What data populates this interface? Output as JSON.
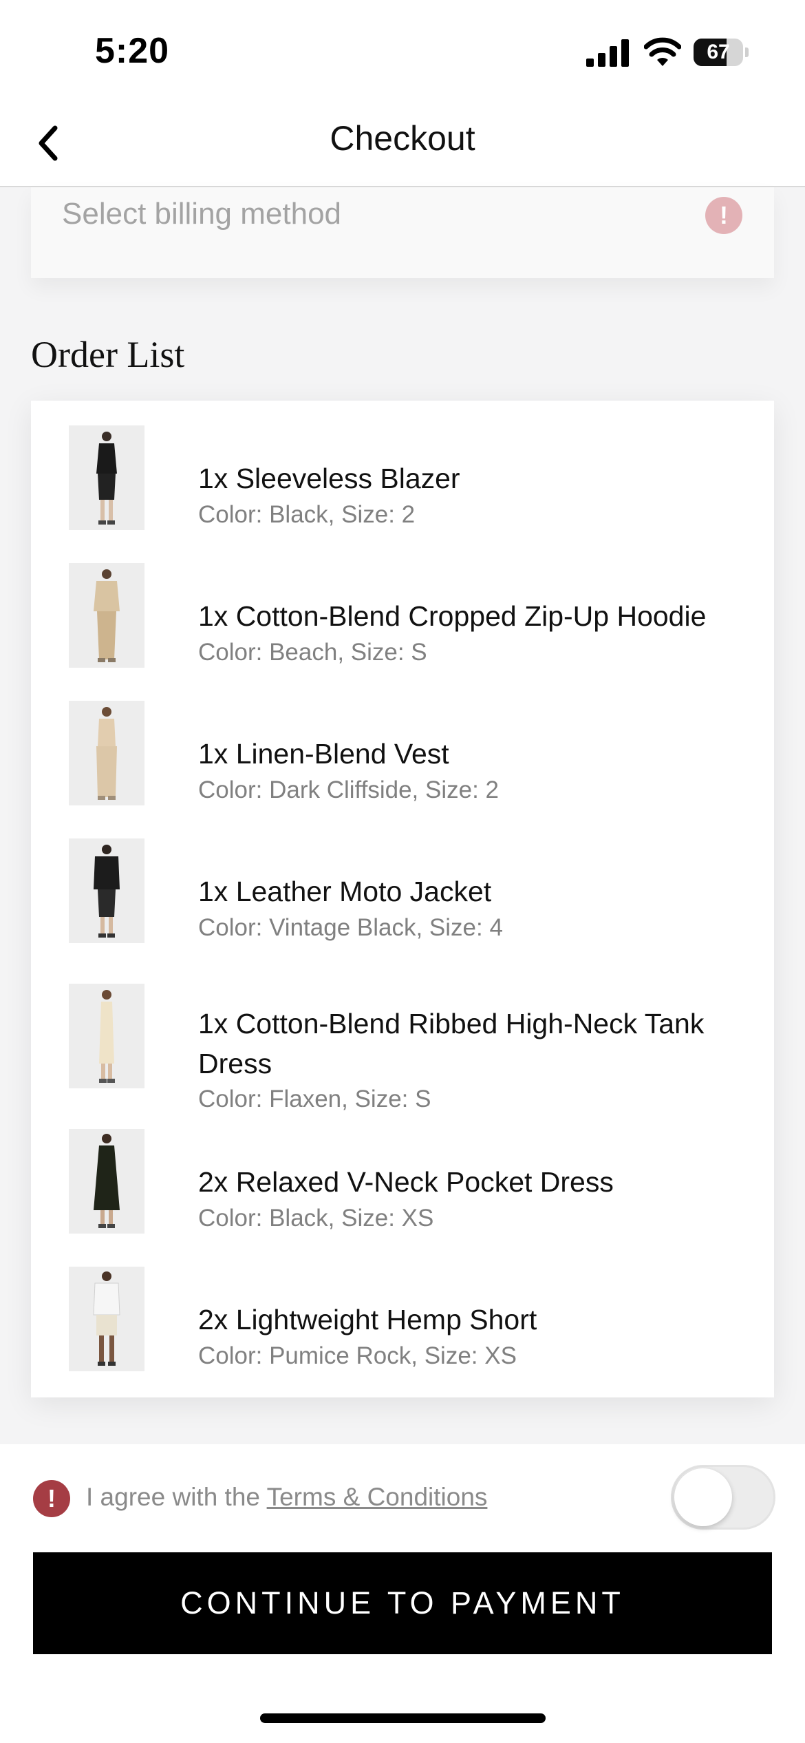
{
  "status_bar": {
    "time": "5:20",
    "battery_percent": "67",
    "battery_level": 0.67
  },
  "nav": {
    "title": "Checkout",
    "back_icon": "chevron-left-icon"
  },
  "billing": {
    "placeholder": "Select billing method",
    "alert_icon": "exclamation-icon"
  },
  "order_list": {
    "title": "Order List",
    "items": [
      {
        "name": "1x Sleeveless Blazer",
        "detail": "Color: Black, Size: 2"
      },
      {
        "name": "1x Cotton-Blend Cropped Zip-Up Hoodie",
        "detail": "Color: Beach, Size: S"
      },
      {
        "name": "1x Linen-Blend Vest",
        "detail": "Color: Dark Cliffside, Size: 2"
      },
      {
        "name": "1x Leather Moto Jacket",
        "detail": "Color: Vintage Black, Size: 4"
      },
      {
        "name": "1x Cotton-Blend Ribbed High-Neck Tank Dress",
        "detail": "Color: Flaxen, Size: S"
      },
      {
        "name": "2x Relaxed V-Neck Pocket Dress",
        "detail": "Color: Black, Size: XS"
      },
      {
        "name": "2x Lightweight Hemp Short",
        "detail": "Color: Pumice Rock, Size: XS"
      }
    ]
  },
  "footer": {
    "terms_prefix": "I agree with the ",
    "terms_link": "Terms & Conditions",
    "terms_accepted": false,
    "cta_label": "CONTINUE TO PAYMENT"
  },
  "colors": {
    "alert": "#a53d44",
    "alert_faded": "#e3b2b6",
    "cta_background": "#000000",
    "page_background": "#f4f4f5"
  }
}
